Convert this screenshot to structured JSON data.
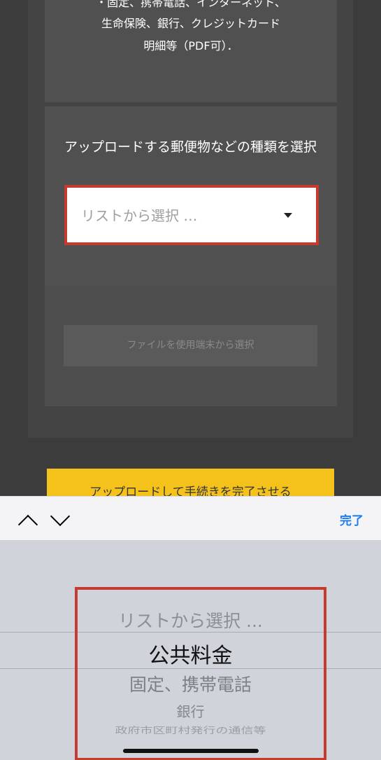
{
  "top_card": {
    "line1": "・固定、携帯電話、インターネット、",
    "line2": "生命保険、銀行、クレジットカード",
    "line3": "明細等（PDF可）．"
  },
  "upload": {
    "label": "アップロードする郵便物などの種類を選択",
    "select_placeholder": "リストから選択 …",
    "file_button": "ファイルを使用端末から選択",
    "submit_button": "アップロードして手続きを完了させる"
  },
  "toolbar": {
    "up_icon": "chevron-up-icon",
    "down_icon": "chevron-down-icon",
    "done_label": "完了",
    "done_color": "#1e7cf2"
  },
  "picker": {
    "options": [
      "リストから選択 ...",
      "公共料金",
      "固定、携帯電話",
      "銀行",
      "政府市区町村発行の通信等"
    ],
    "selected_index": 1
  },
  "colors": {
    "highlight_border": "#c53b2f",
    "submit_bg": "#f5c21c"
  }
}
